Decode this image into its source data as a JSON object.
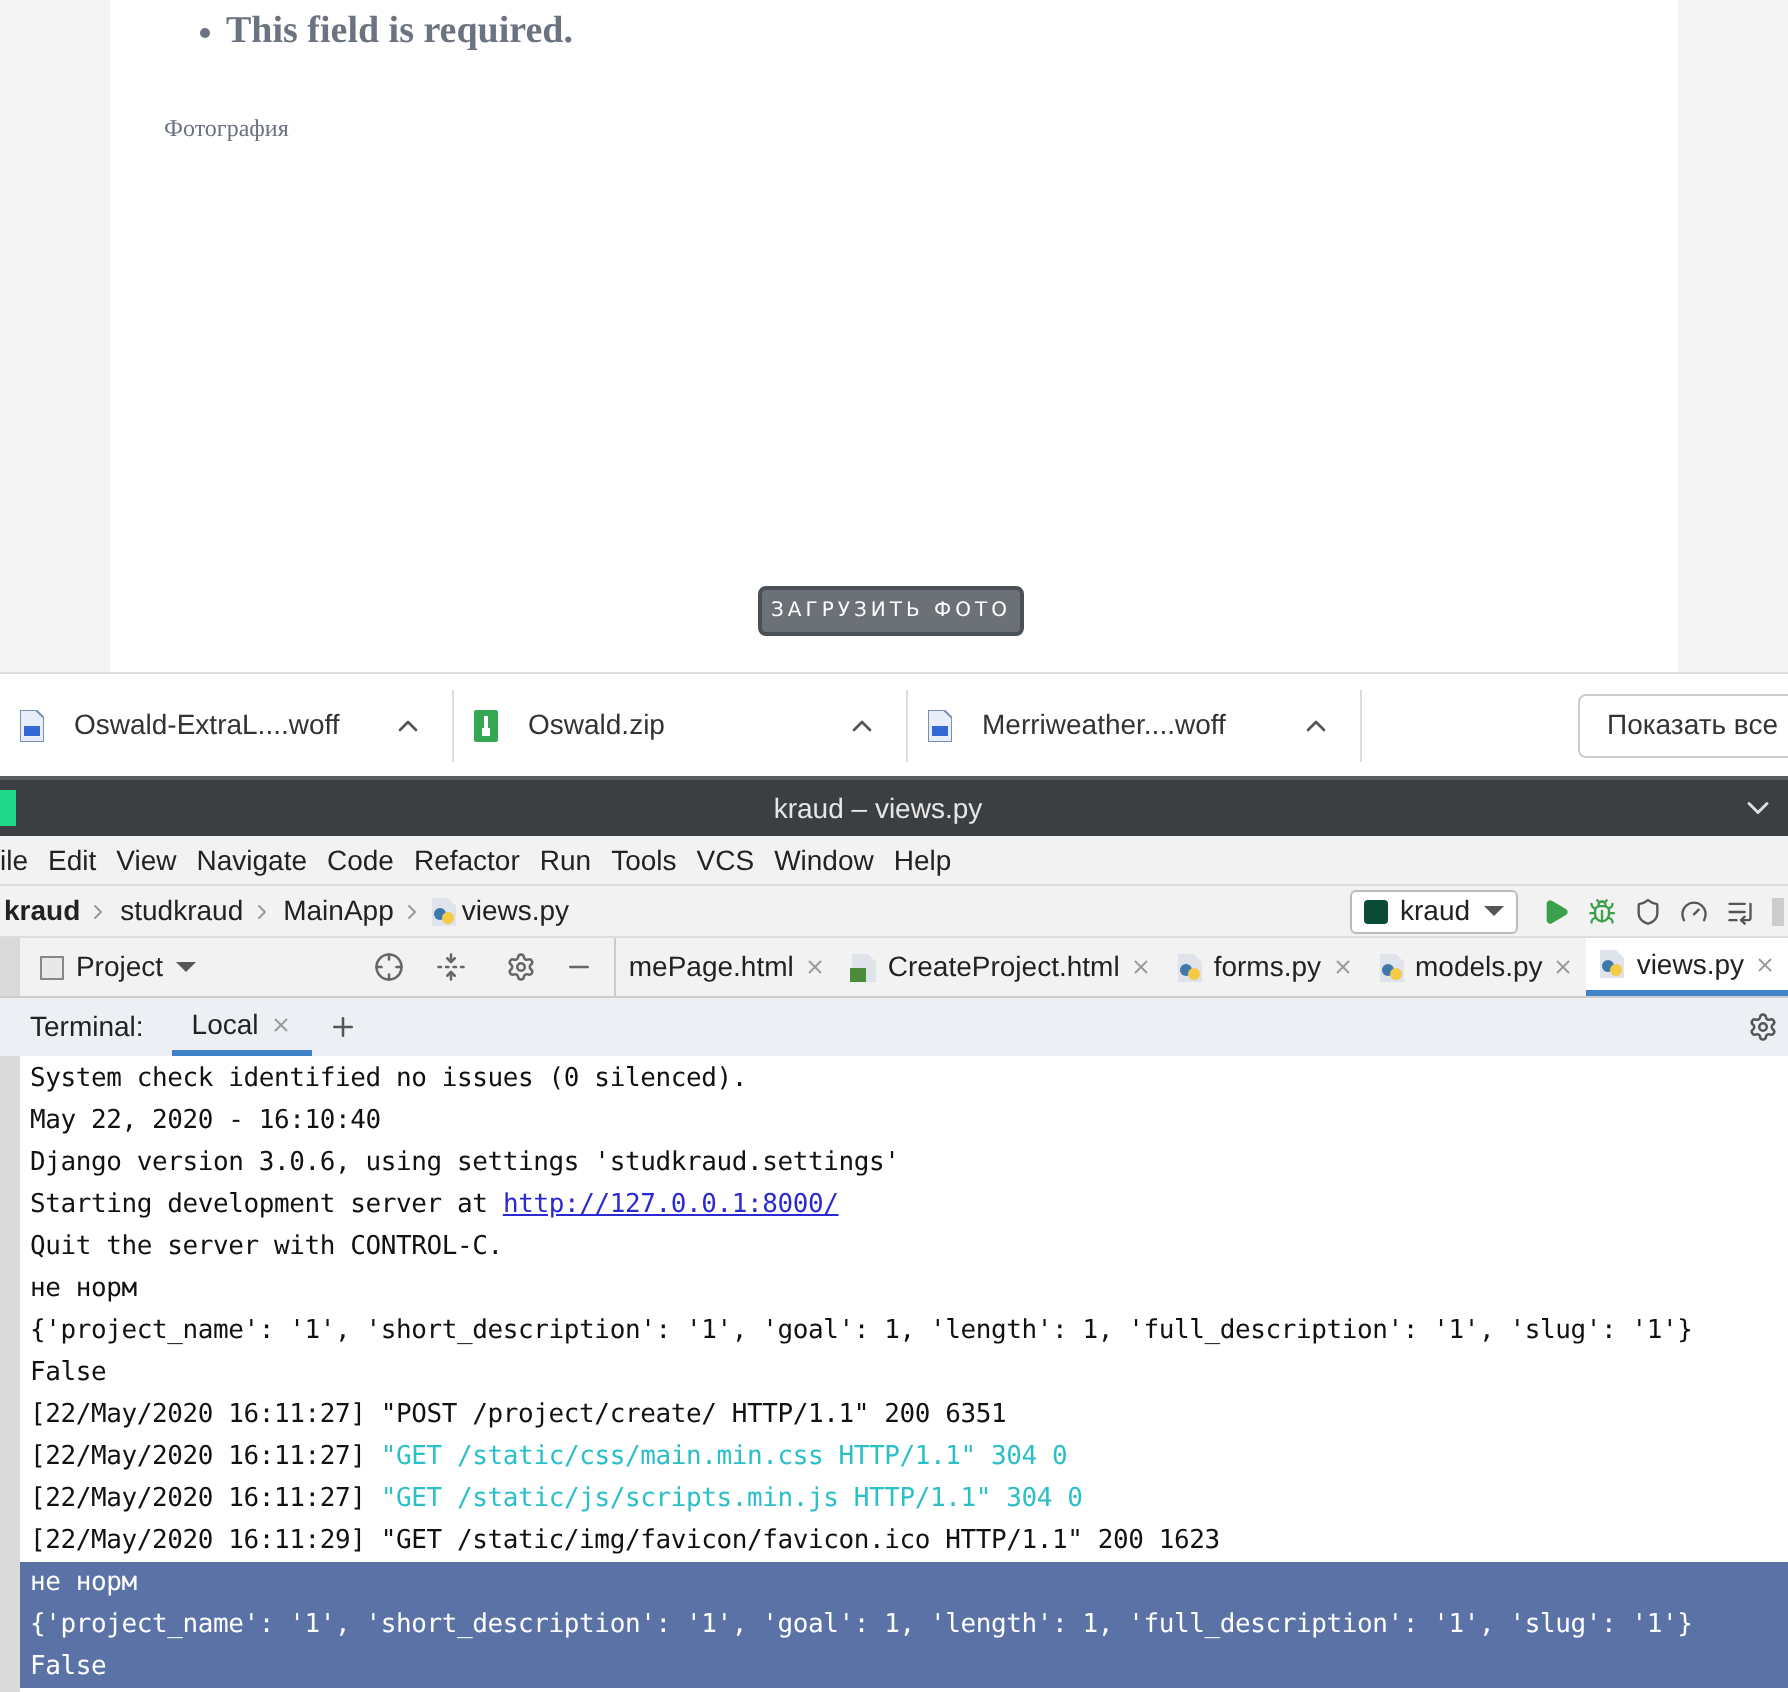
{
  "page": {
    "error": "This field is required.",
    "photo_label": "Фотография",
    "upload_button": "ЗАГРУЗИТЬ ФОТО"
  },
  "downloads": {
    "items": [
      {
        "name": "Oswald-ExtraL....woff",
        "kind": "font"
      },
      {
        "name": "Oswald.zip",
        "kind": "archive"
      },
      {
        "name": "Merriweather....woff",
        "kind": "font"
      }
    ],
    "show_all": "Показать все"
  },
  "ide": {
    "title": "kraud – views.py",
    "menu": [
      "ile",
      "Edit",
      "View",
      "Navigate",
      "Code",
      "Refactor",
      "Run",
      "Tools",
      "VCS",
      "Window",
      "Help"
    ],
    "breadcrumbs": [
      "kraud",
      "studkraud",
      "MainApp",
      "views.py"
    ],
    "run_config": "kraud",
    "project_panel": "Project",
    "editor_tabs": [
      {
        "label": "mePage.html",
        "kind": "plain",
        "selected": false
      },
      {
        "label": "CreateProject.html",
        "kind": "html",
        "selected": false
      },
      {
        "label": "forms.py",
        "kind": "python",
        "selected": false
      },
      {
        "label": "models.py",
        "kind": "python",
        "selected": false
      },
      {
        "label": "views.py",
        "kind": "python",
        "selected": true
      }
    ],
    "terminal": {
      "label": "Terminal:",
      "tabs": [
        {
          "label": "Local",
          "selected": true
        }
      ],
      "lines": [
        {
          "selected": false,
          "parts": [
            {
              "kind": "plain",
              "text": "System check identified no issues (0 silenced)."
            }
          ]
        },
        {
          "selected": false,
          "parts": [
            {
              "kind": "plain",
              "text": "May 22, 2020 - 16:10:40"
            }
          ]
        },
        {
          "selected": false,
          "parts": [
            {
              "kind": "plain",
              "text": "Django version 3.0.6, using settings 'studkraud.settings'"
            }
          ]
        },
        {
          "selected": false,
          "parts": [
            {
              "kind": "plain",
              "text": "Starting development server at "
            },
            {
              "kind": "link",
              "text": "http://127.0.0.1:8000/"
            }
          ]
        },
        {
          "selected": false,
          "parts": [
            {
              "kind": "plain",
              "text": "Quit the server with CONTROL-C."
            }
          ]
        },
        {
          "selected": false,
          "parts": [
            {
              "kind": "plain",
              "text": "не норм"
            }
          ]
        },
        {
          "selected": false,
          "parts": [
            {
              "kind": "plain",
              "text": "{'project_name': '1', 'short_description': '1', 'goal': 1, 'length': 1, 'full_description': '1', 'slug': '1'}"
            }
          ]
        },
        {
          "selected": false,
          "parts": [
            {
              "kind": "plain",
              "text": "False"
            }
          ]
        },
        {
          "selected": false,
          "parts": [
            {
              "kind": "plain",
              "text": "[22/May/2020 16:11:27] \"POST /project/create/ HTTP/1.1\" 200 6351"
            }
          ]
        },
        {
          "selected": false,
          "parts": [
            {
              "kind": "plain",
              "text": "[22/May/2020 16:11:27] "
            },
            {
              "kind": "cached",
              "text": "\"GET /static/css/main.min.css HTTP/1.1\" 304 0"
            }
          ]
        },
        {
          "selected": false,
          "parts": [
            {
              "kind": "plain",
              "text": "[22/May/2020 16:11:27] "
            },
            {
              "kind": "cached",
              "text": "\"GET /static/js/scripts.min.js HTTP/1.1\" 304 0"
            }
          ]
        },
        {
          "selected": false,
          "parts": [
            {
              "kind": "plain",
              "text": "[22/May/2020 16:11:29] \"GET /static/img/favicon/favicon.ico HTTP/1.1\" 200 1623"
            }
          ]
        },
        {
          "selected": true,
          "parts": [
            {
              "kind": "plain",
              "text": "не норм"
            }
          ]
        },
        {
          "selected": true,
          "parts": [
            {
              "kind": "plain",
              "text": "{'project_name': '1', 'short_description': '1', 'goal': 1, 'length': 1, 'full_description': '1', 'slug': '1'}"
            }
          ]
        },
        {
          "selected": true,
          "parts": [
            {
              "kind": "plain",
              "text": "False"
            }
          ]
        }
      ]
    }
  }
}
